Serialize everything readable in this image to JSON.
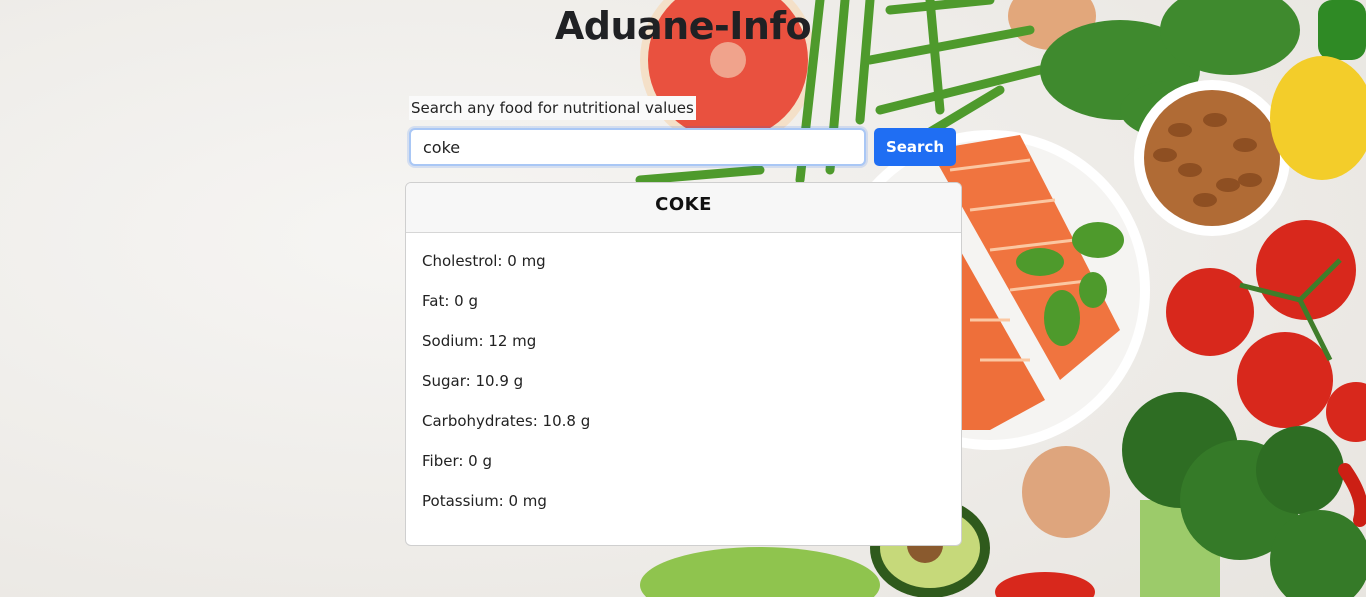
{
  "app": {
    "title": "Aduane-Info"
  },
  "search": {
    "label": "Search any food for nutritional values",
    "value": "coke",
    "button_label": "Search"
  },
  "result": {
    "food_name": "COKE",
    "nutrients": [
      {
        "text": "Cholestrol: 0 mg"
      },
      {
        "text": "Fat: 0 g"
      },
      {
        "text": "Sodium: 12 mg"
      },
      {
        "text": "Sugar: 10.9 g"
      },
      {
        "text": "Carbohydrates: 10.8 g"
      },
      {
        "text": "Fiber: 0 g"
      },
      {
        "text": "Potassium: 0 mg"
      }
    ]
  },
  "colors": {
    "accent": "#1f6ef3",
    "background": "#efedea",
    "card": "#ffffff"
  }
}
